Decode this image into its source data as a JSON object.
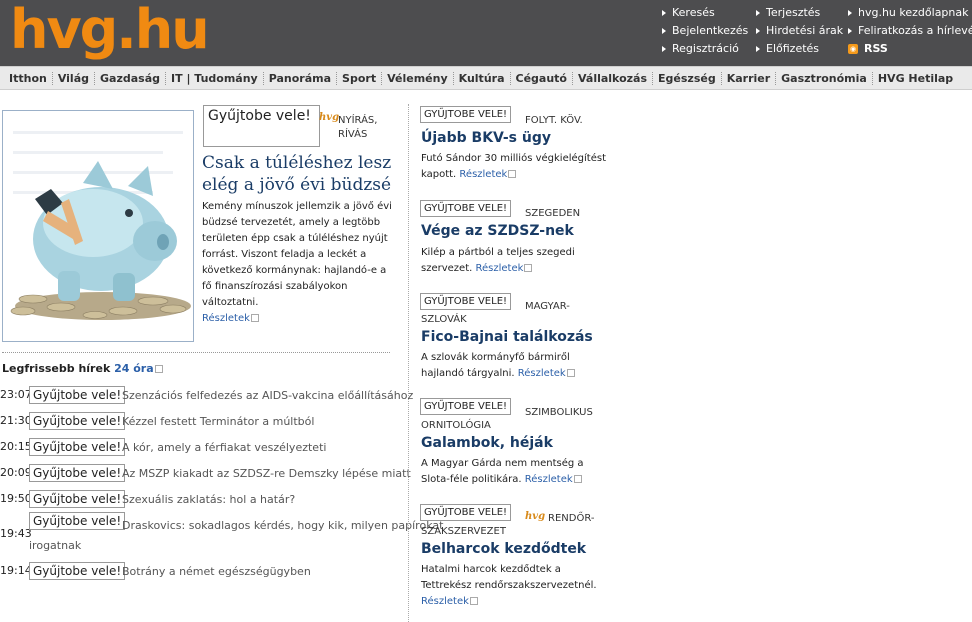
{
  "header": {
    "logo": "hvg.hu",
    "links": {
      "col1": [
        "Keresés",
        "Bejelentkezés",
        "Regisztráció"
      ],
      "col2": [
        "Terjesztés",
        "Hirdetési árak",
        "Előfizetés"
      ],
      "col3": [
        "hvg.hu kezdőlapnak",
        "Feliratkozás a hírlevélre",
        "RSS"
      ]
    }
  },
  "nav": {
    "items": [
      "Itthon",
      "Világ",
      "Gazdaság",
      "IT | Tudomány",
      "Panoráma",
      "Sport",
      "Vélemény",
      "Kultúra",
      "Cégautó",
      "Vállalkozás",
      "Egészség",
      "Karrier",
      "Gasztronómia",
      "HVG Hetilap"
    ]
  },
  "collect_label": "Gyűjtobe vele!",
  "collect_label_caps": "GYŰJTOBE VELE!",
  "more_label": "Részletek",
  "hvg_mark": "hvg",
  "featured": {
    "kicker": "NYÍRÁS, RÍVÁS",
    "title": "Csak a túléléshez lesz elég a jövő évi büdzsé",
    "lead": "Kemény mínuszok jellemzik a jövő évi büdzsé tervezetét, amely a legtöbb területen épp csak a túléléshez nyújt forrást. Viszont feladja a leckét a következő kormánynak: hajlandó-e a fő finanszírozási szabályokon változtatni."
  },
  "latest": {
    "heading": "Legfrissebb hírek",
    "range": "24 óra",
    "items": [
      {
        "time": "23:07",
        "text": "Szenzációs felfedezés az AIDS-vakcina előállításához"
      },
      {
        "time": "21:30",
        "text": "Kézzel festett Terminátor a múltból"
      },
      {
        "time": "20:15",
        "text": "A kór, amely a férfiakat veszélyezteti"
      },
      {
        "time": "20:09",
        "text": "Az MSZP kiakadt az SZDSZ-re Demszky lépése miatt"
      },
      {
        "time": "19:50",
        "text": "Szexuális zaklatás: hol a határ?"
      },
      {
        "time": "19:43",
        "text": "Draskovics: sokadlagos kérdés, hogy kik, milyen papírokat",
        "text2": "irogatnak"
      },
      {
        "time": "19:14",
        "text": "Botrány a német egészségügyben"
      }
    ]
  },
  "right": {
    "stories": [
      {
        "kicker": "FOLYT. KÖV.",
        "title": "Újabb BKV-s ügy",
        "lead": "Futó Sándor 30 milliós végkielégítést kapott."
      },
      {
        "kicker": "SZEGEDEN",
        "title": "Vége az SZDSZ-nek",
        "lead": "Kilép a pártból a teljes szegedi szervezet."
      },
      {
        "kicker": "MAGYAR-",
        "kicker2": "SZLOVÁK",
        "title": "Fico-Bajnai találkozás",
        "lead": "A szlovák kormányfő bármiről hajlandó tárgyalni."
      },
      {
        "kicker": "SZIMBOLIKUS",
        "kicker2": "ORNITOLÓGIA",
        "title": "Galambok, héják",
        "lead": "A Magyar Gárda nem mentség a Slota-féle politikára."
      },
      {
        "kicker": "RENDŐR-",
        "kicker2": "SZAKSZERVEZET",
        "title": "Belharcok kezdődtek",
        "lead": "Hatalmi harcok kezdődtek a Tettrekész rendőrszakszervezetnél."
      }
    ]
  }
}
